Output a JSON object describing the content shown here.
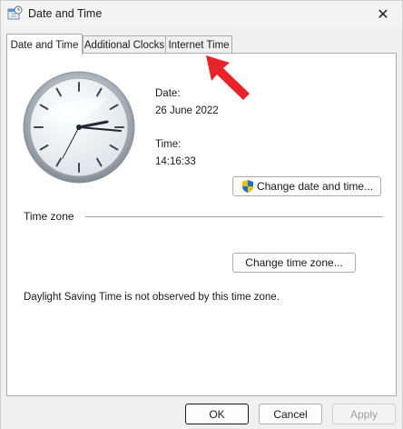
{
  "window": {
    "title": "Date and Time",
    "close_glyph": "✕"
  },
  "tabs": [
    {
      "label": "Date and Time",
      "active": true
    },
    {
      "label": "Additional Clocks",
      "active": false
    },
    {
      "label": "Internet Time",
      "active": false
    }
  ],
  "datetime": {
    "date_label": "Date:",
    "date_value": "26 June 2022",
    "time_label": "Time:",
    "time_value": "14:16:33",
    "change_button": "Change date and time..."
  },
  "timezone": {
    "heading": "Time zone",
    "change_button": "Change time zone...",
    "dst_note": "Daylight Saving Time is not observed by this time zone."
  },
  "footer": {
    "ok": "OK",
    "cancel": "Cancel",
    "apply": "Apply"
  },
  "colors": {
    "annotation_arrow": "#e8242a",
    "shield_blue": "#1e6fd9",
    "shield_yellow": "#f2c200"
  },
  "icons": {
    "title": "date-time-icon",
    "close": "close-icon",
    "shield": "uac-shield-icon",
    "annotation": "red-arrow-icon"
  }
}
